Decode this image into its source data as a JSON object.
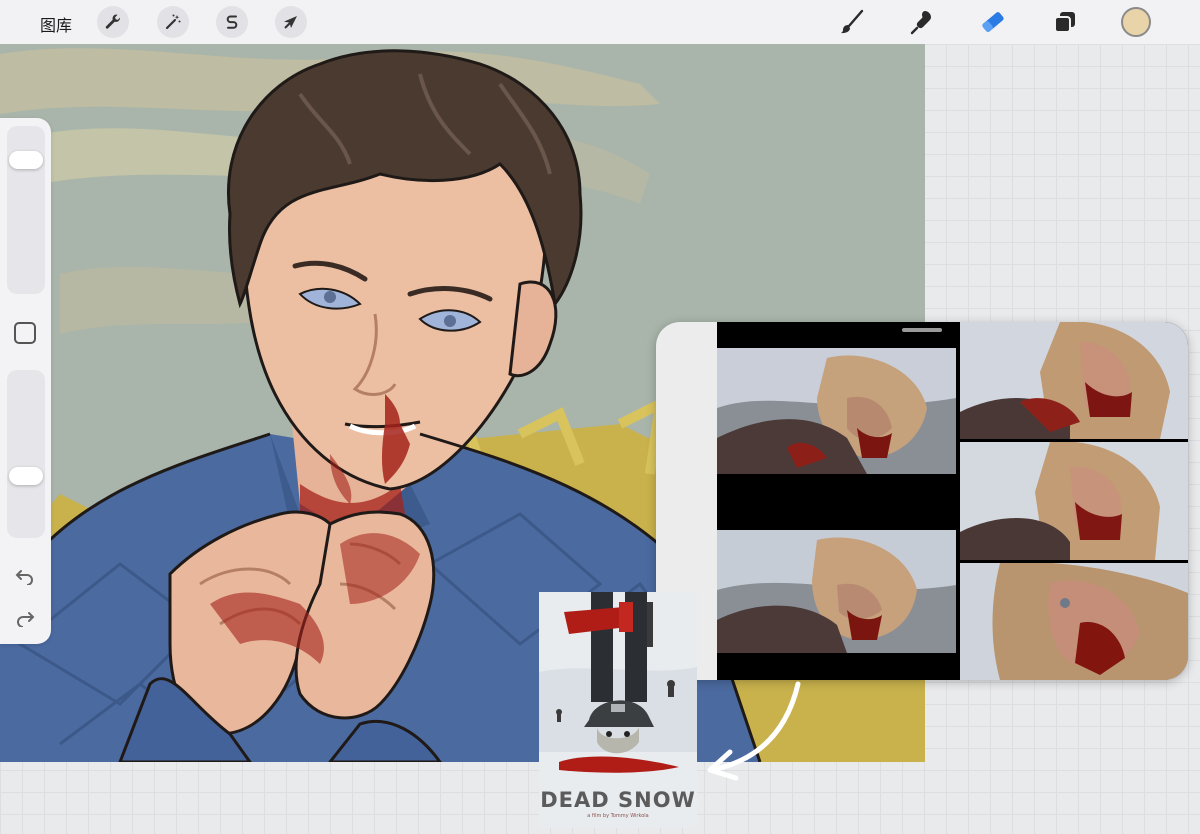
{
  "toolbar": {
    "gallery_label": "图库",
    "left_tools": [
      {
        "name": "actions",
        "icon": "wrench-icon"
      },
      {
        "name": "adjustments",
        "icon": "magic-wand-icon"
      },
      {
        "name": "selection",
        "icon": "selection-s-icon"
      },
      {
        "name": "transform",
        "icon": "arrow-cursor-icon"
      }
    ],
    "right_tools": [
      {
        "name": "brush",
        "icon": "brush-icon"
      },
      {
        "name": "smudge",
        "icon": "smudge-icon"
      },
      {
        "name": "eraser",
        "icon": "eraser-icon",
        "active": true
      },
      {
        "name": "layers",
        "icon": "layers-icon"
      }
    ],
    "active_color": "#e8d4a8",
    "accent_color": "#2c7be5"
  },
  "sidebar": {
    "brush_size_level": 0.84,
    "opacity_level": 0.35,
    "modify_button": "square-icon",
    "undo": "undo-icon",
    "redo": "redo-icon"
  },
  "reference_panel": {
    "frames": 5
  },
  "poster": {
    "title": "DEAD SNOW",
    "credit": "a film by Tommy Wirkola"
  },
  "colors": {
    "canvas_bg": "#a9b5aa",
    "shirt_blue": "#4b6aa0",
    "skin": "#e9b79c",
    "hair": "#4a3a30",
    "blood": "#a4221a",
    "yellow_field": "#c9b24c"
  }
}
